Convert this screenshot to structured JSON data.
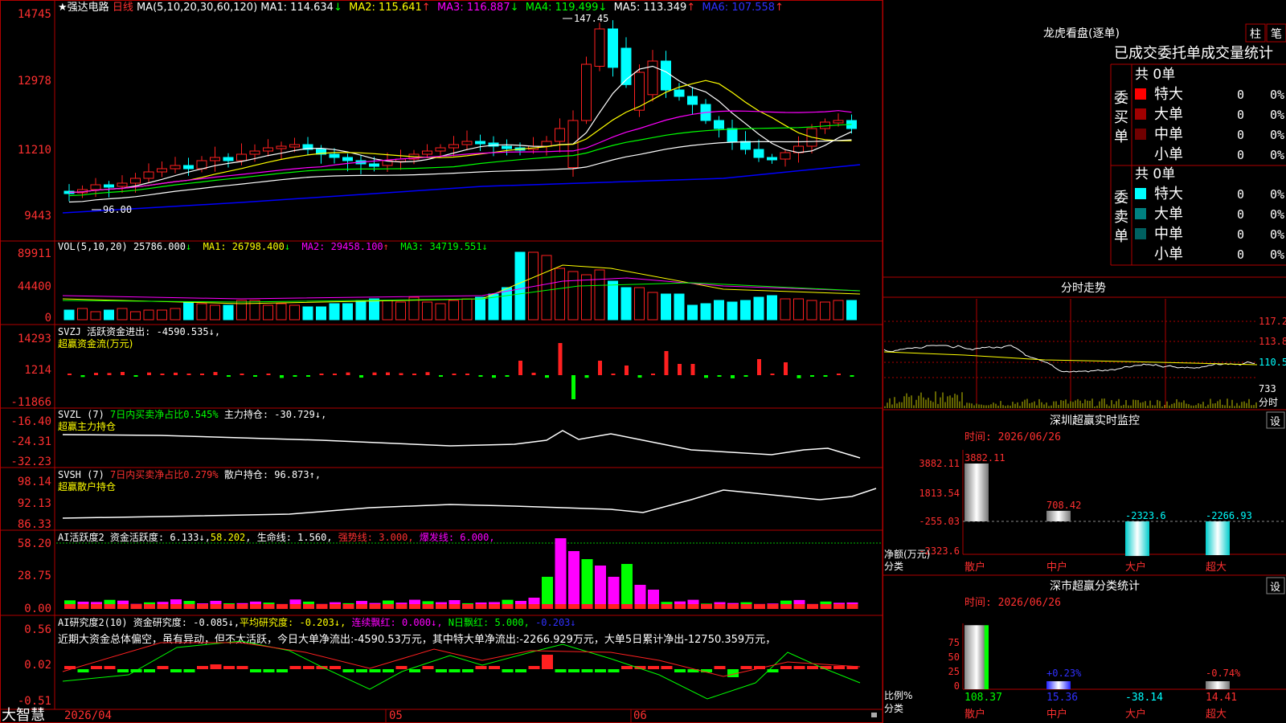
{
  "colors": {
    "bg": "#000000",
    "up": "#ff2020",
    "down": "#00ffff",
    "grid": "#b00000",
    "ma_yellow": "#ffff00",
    "ma_magenta": "#ff00ff",
    "ma_green": "#00ff00",
    "ma_blue": "#0000ff",
    "white": "#ffffff"
  },
  "main": {
    "star": "★",
    "stock_name": "强达电路",
    "period": "日线",
    "ma_header": "MA(5,10,20,30,60,120)",
    "ma": [
      {
        "label": "MA1: 114.634",
        "arrow": "↓",
        "color": "#ffffff"
      },
      {
        "label": "MA2: 115.641",
        "arrow": "↑",
        "color": "#ffff00"
      },
      {
        "label": "MA3: 116.887",
        "arrow": "↓",
        "color": "#ff00ff"
      },
      {
        "label": "MA4: 119.499",
        "arrow": "↓",
        "color": "#00ff00"
      },
      {
        "label": "MA5: 113.349",
        "arrow": "↑",
        "color": "#ffffff"
      },
      {
        "label": "MA6: 107.558",
        "arrow": "↑",
        "color": "#0000ff"
      }
    ],
    "y_ticks": [
      "14745",
      "12978",
      "11210",
      "9443"
    ],
    "high_label": "147.45",
    "low_label": "96.00"
  },
  "vol": {
    "header": "VOL(5,10,20)",
    "value": "25786.000",
    "value_arrow": "↓",
    "items": [
      {
        "label": "MA1: 26798.400",
        "arrow": "↓",
        "color": "#ffff00"
      },
      {
        "label": "MA2: 29458.100",
        "arrow": "↑",
        "color": "#ff00ff"
      },
      {
        "label": "MA3: 34719.551",
        "arrow": "↓",
        "color": "#00ff00"
      }
    ],
    "y_ticks": [
      "89911",
      "44400",
      "0"
    ]
  },
  "svzj": {
    "line1": "SVZJ  活跃资金进出: -4590.535↓,",
    "line2": "超赢资金流(万元)",
    "y_ticks": [
      "14293",
      "1214",
      "-11866"
    ]
  },
  "svzl": {
    "prefix": "SVZL (7) ",
    "mid": "7日内买卖净占比0.545%",
    "hold": " 主力持仓: -30.729↓,",
    "line2": "超赢主力持仓",
    "y_ticks": [
      "-16.40",
      "-24.31",
      "-32.23"
    ]
  },
  "svsh": {
    "prefix": "SVSH (7) ",
    "mid": "7日内买卖净占比0.279%",
    "hold": " 散户持仓: 96.873↑,",
    "line2": "超赢散户持仓",
    "y_ticks": [
      "98.14",
      "92.13",
      "86.33"
    ]
  },
  "ai_active": {
    "p1": "AI活跃度2 资金活跃度: 6.133↓,",
    "p2": "58.202",
    "p3": ", 生命线: 1.560,",
    "p4": "强势线: 3.000,",
    "p5": "爆发线: 6.000,",
    "y_ticks": [
      "58.20",
      "28.75",
      "0.00"
    ]
  },
  "ai_research": {
    "p1": "AI研究度2(10) 资金研究度: -0.085↓,",
    "p2": "平均研究度: -0.203↓,",
    "p3": "连续飘红: 0.000↓,",
    "p4": "N日飘红: 5.000,",
    "p5": "-0.203↓",
    "desc": "近期大资金总体偏空，虽有异动，但不太活跃，今日大单净流出:-4590.53万元，其中特大单净流出:-2266.929万元，大单5日累计净出-12750.359万元，",
    "y_ticks": [
      "0.56",
      "0.02",
      "-0.51"
    ]
  },
  "xaxis": {
    "labels": [
      "2026/04",
      "05",
      "06"
    ]
  },
  "brand": "大智慧",
  "longhu": {
    "title": "龙虎看盘(逐单)",
    "btn1": "柱",
    "btn2": "笔",
    "header": "已成交委托单成交量统计",
    "buy_label": "委买单",
    "sell_label": "委卖单",
    "buy_total": "共 0单",
    "sell_total": "共 0单",
    "buy_rows": [
      {
        "name": "特大",
        "vol": "0",
        "pct": "0%",
        "color": "#ff0000"
      },
      {
        "name": "大单",
        "vol": "0",
        "pct": "0%",
        "color": "#a00000"
      },
      {
        "name": "中单",
        "vol": "0",
        "pct": "0%",
        "color": "#700000"
      },
      {
        "name": "小单",
        "vol": "0",
        "pct": "0%",
        "color": "#000000"
      }
    ],
    "sell_rows": [
      {
        "name": "特大",
        "vol": "0",
        "pct": "0%",
        "color": "#00ffff"
      },
      {
        "name": "大单",
        "vol": "0",
        "pct": "0%",
        "color": "#008080"
      },
      {
        "name": "中单",
        "vol": "0",
        "pct": "0%",
        "color": "#006060"
      },
      {
        "name": "小单",
        "vol": "0",
        "pct": "0%",
        "color": "#000000"
      }
    ]
  },
  "fenshi": {
    "title": "分时走势",
    "y_ticks": [
      "117.2",
      "113.8",
      "110.5"
    ],
    "vol_tick": "733",
    "unit": "分时"
  },
  "szjk": {
    "title": "深圳超赢实时监控",
    "btn": "设",
    "time": "时间: 2026/06/26",
    "y_ticks": [
      "3882.11",
      "1813.54",
      "-255.03",
      "-2323.6"
    ],
    "ylabel": "净额(万元)",
    "xlabel_name": "分类",
    "cats": [
      "散户",
      "中户",
      "大户",
      "超大"
    ],
    "values": [
      "3882.11",
      "708.42",
      "-2323.6",
      "-2266.93"
    ]
  },
  "szfl": {
    "title": "深市超赢分类统计",
    "btn": "设",
    "time": "时间: 2026/06/26",
    "y_ticks": [
      "75",
      "50",
      "25",
      "0"
    ],
    "ylabel": "比例%",
    "xlabel_name": "分类",
    "cats": [
      "散户",
      "中户",
      "大户",
      "超大"
    ],
    "bar_labels": [
      "",
      "+0.23%",
      "",
      "-0.74%"
    ],
    "values": [
      "108.37",
      "15.36",
      "-38.14",
      "14.41"
    ]
  }
}
